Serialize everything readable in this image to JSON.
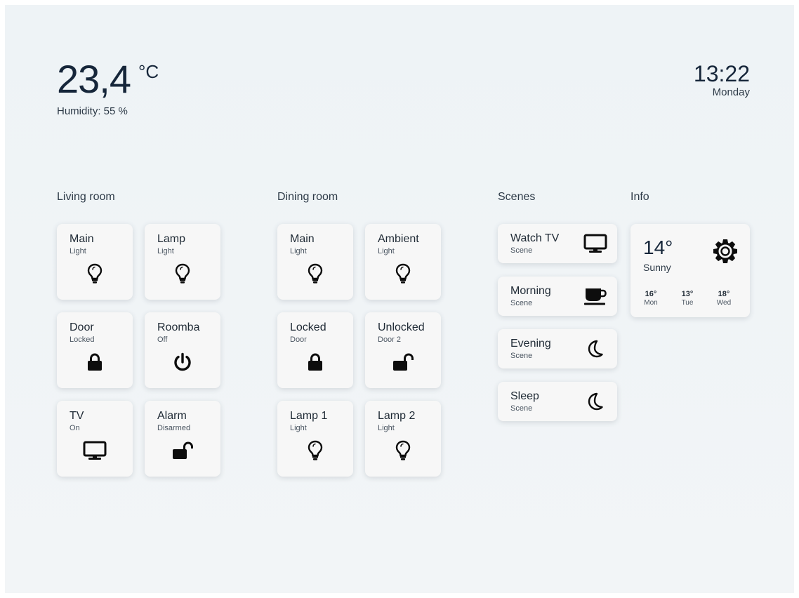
{
  "header": {
    "temperature": "23,4",
    "temperature_unit": "°C",
    "humidity": "Humidity: 55 %",
    "time": "13:22",
    "day": "Monday"
  },
  "sections": {
    "living_room": "Living room",
    "dining_room": "Dining room",
    "scenes": "Scenes",
    "info": "Info"
  },
  "living_room": [
    {
      "title": "Main",
      "subtitle": "Light",
      "icon": "bulb-icon"
    },
    {
      "title": "Lamp",
      "subtitle": "Light",
      "icon": "bulb-icon"
    },
    {
      "title": "Door",
      "subtitle": "Locked",
      "icon": "lock-icon"
    },
    {
      "title": "Roomba",
      "subtitle": "Off",
      "icon": "power-icon"
    },
    {
      "title": "TV",
      "subtitle": "On",
      "icon": "tv-icon"
    },
    {
      "title": "Alarm",
      "subtitle": "Disarmed",
      "icon": "unlock-icon"
    }
  ],
  "dining_room": [
    {
      "title": "Main",
      "subtitle": "Light",
      "icon": "bulb-icon"
    },
    {
      "title": "Ambient",
      "subtitle": "Light",
      "icon": "bulb-icon"
    },
    {
      "title": "Locked",
      "subtitle": "Door",
      "icon": "lock-icon"
    },
    {
      "title": "Unlocked",
      "subtitle": "Door 2",
      "icon": "unlock-icon"
    },
    {
      "title": "Lamp 1",
      "subtitle": "Light",
      "icon": "bulb-icon"
    },
    {
      "title": "Lamp 2",
      "subtitle": "Light",
      "icon": "bulb-icon"
    }
  ],
  "scenes": [
    {
      "title": "Watch TV",
      "subtitle": "Scene",
      "icon": "tv-icon"
    },
    {
      "title": "Morning",
      "subtitle": "Scene",
      "icon": "coffee-cup-icon"
    },
    {
      "title": "Evening",
      "subtitle": "Scene",
      "icon": "moon-icon"
    },
    {
      "title": "Sleep",
      "subtitle": "Scene",
      "icon": "moon-icon"
    }
  ],
  "weather": {
    "temperature": "14°",
    "condition": "Sunny",
    "icon": "sun-icon",
    "forecast": [
      {
        "temp": "16°",
        "day": "Mon"
      },
      {
        "temp": "13°",
        "day": "Tue"
      },
      {
        "temp": "18°",
        "day": "Wed"
      }
    ]
  },
  "colors": {
    "background": "#eef3f6",
    "card": "#f7f7f7",
    "icon": "#0d0d0d",
    "text": "#16263a"
  }
}
